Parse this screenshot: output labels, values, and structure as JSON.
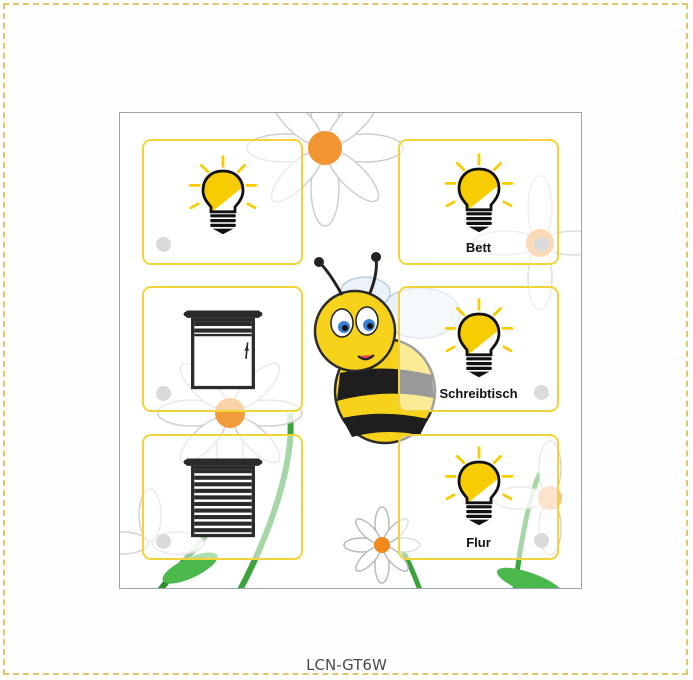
{
  "device": {
    "model_label": "LCN-GT6W"
  },
  "buttons": [
    {
      "name": "light-button-1",
      "icon": "light-bulb-icon",
      "label": "",
      "status": "off"
    },
    {
      "name": "light-button-bett",
      "icon": "light-bulb-icon",
      "label": "Bett",
      "status": "off"
    },
    {
      "name": "shutter-button-1",
      "icon": "window-shutter-open-icon",
      "label": "",
      "status": "off"
    },
    {
      "name": "light-button-schreibtisch",
      "icon": "light-bulb-icon",
      "label": "Schreibtisch",
      "status": "off"
    },
    {
      "name": "shutter-button-2",
      "icon": "window-shutter-closed-icon",
      "label": "",
      "status": "off"
    },
    {
      "name": "light-button-flur",
      "icon": "light-bulb-icon",
      "label": "Flur",
      "status": "off"
    }
  ],
  "colors": {
    "button_border": "#f2d43a",
    "bulb_yellow": "#f7cc00",
    "indicator_off": "#dadada",
    "frame_border": "#e0c86a"
  }
}
